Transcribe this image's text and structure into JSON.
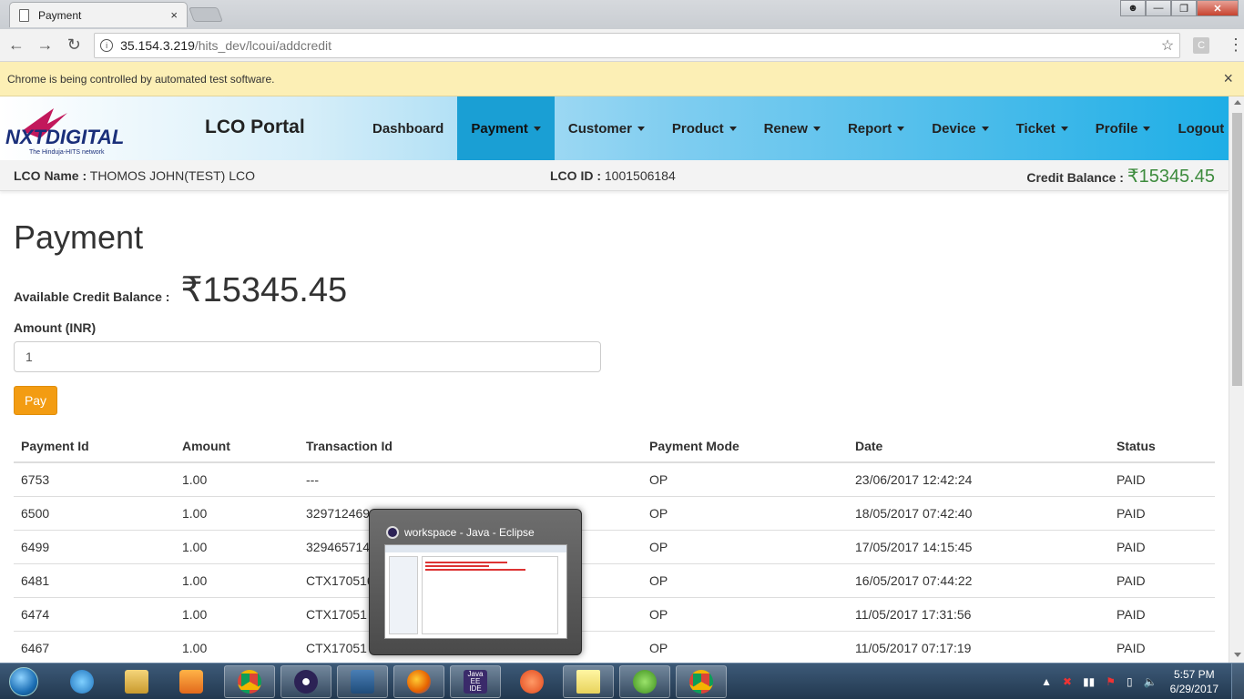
{
  "browser": {
    "tab_title": "Payment",
    "tab_close": "×",
    "url_host": "35.154.3.219",
    "url_path": "/hits_dev/lcoui/addcredit",
    "infobar_text": "Chrome is being controlled by automated test software.",
    "infobar_close": "×",
    "ext_label": "C"
  },
  "nav": {
    "portal_title": "LCO Portal",
    "logo_text": "NXTDIGITAL",
    "logo_tagline": "The Hinduja-HITS network",
    "items": [
      {
        "label": "Dashboard",
        "dropdown": false,
        "active": false
      },
      {
        "label": "Payment",
        "dropdown": true,
        "active": true
      },
      {
        "label": "Customer",
        "dropdown": true,
        "active": false
      },
      {
        "label": "Product",
        "dropdown": true,
        "active": false
      },
      {
        "label": "Renew",
        "dropdown": true,
        "active": false
      },
      {
        "label": "Report",
        "dropdown": true,
        "active": false
      },
      {
        "label": "Device",
        "dropdown": true,
        "active": false
      },
      {
        "label": "Ticket",
        "dropdown": true,
        "active": false
      },
      {
        "label": "Profile",
        "dropdown": true,
        "active": false
      },
      {
        "label": "Logout",
        "dropdown": false,
        "active": false
      }
    ]
  },
  "lco": {
    "name_label": "LCO Name :",
    "name_value": "THOMOS JOHN(TEST) LCO",
    "id_label": "LCO ID :",
    "id_value": "1001506184",
    "credit_label": "Credit Balance :",
    "credit_value": "₹15345.45"
  },
  "page": {
    "title": "Payment",
    "available_label": "Available Credit Balance :",
    "available_value": "₹15345.45",
    "amount_label": "Amount (INR)",
    "amount_value": "1",
    "pay_button": "Pay"
  },
  "table": {
    "headers": [
      "Payment Id",
      "Amount",
      "Transaction Id",
      "Payment Mode",
      "Date",
      "Status"
    ],
    "rows": [
      [
        "6753",
        "1.00",
        "---",
        "OP",
        "23/06/2017 12:42:24",
        "PAID"
      ],
      [
        "6500",
        "1.00",
        "329712469",
        "OP",
        "18/05/2017 07:42:40",
        "PAID"
      ],
      [
        "6499",
        "1.00",
        "329465714",
        "OP",
        "17/05/2017 14:15:45",
        "PAID"
      ],
      [
        "6481",
        "1.00",
        "CTX170516",
        "OP",
        "16/05/2017 07:44:22",
        "PAID"
      ],
      [
        "6474",
        "1.00",
        "CTX17051",
        "OP",
        "11/05/2017 17:31:56",
        "PAID"
      ],
      [
        "6467",
        "1.00",
        "CTX17051",
        "OP",
        "11/05/2017 07:17:19",
        "PAID"
      ]
    ]
  },
  "preview": {
    "title": "workspace - Java - Eclipse"
  },
  "taskbar": {
    "apps": [
      "internet-explorer",
      "file-explorer",
      "media-player",
      "chrome",
      "eclipse",
      "wireshark",
      "firefox",
      "java-ee-ide",
      "tool",
      "sticky-notes",
      "utorrent",
      "chrome"
    ],
    "java_ee_label": "Java EE IDE",
    "clock_time": "5:57 PM",
    "clock_date": "6/29/2017"
  }
}
